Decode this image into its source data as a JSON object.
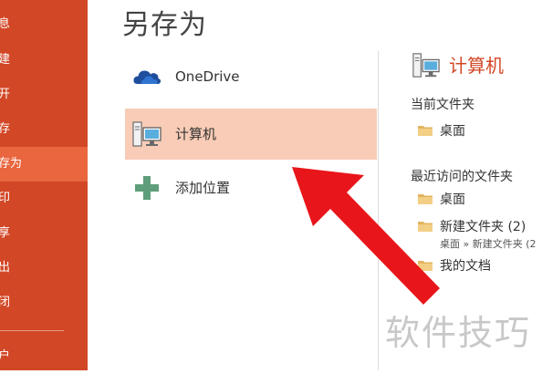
{
  "sidebar": {
    "items": [
      {
        "label": "息"
      },
      {
        "label": "建"
      },
      {
        "label": "开"
      },
      {
        "label": "存"
      },
      {
        "label": "存为"
      },
      {
        "label": "印"
      },
      {
        "label": "享"
      },
      {
        "label": "出"
      },
      {
        "label": "闭"
      },
      {
        "label": "户"
      }
    ],
    "active_index": 4
  },
  "page": {
    "title": "另存为"
  },
  "places": [
    {
      "label": "OneDrive",
      "icon": "cloud-icon"
    },
    {
      "label": "计算机",
      "icon": "computer-icon",
      "selected": true
    },
    {
      "label": "添加位置",
      "icon": "plus-icon"
    }
  ],
  "right_pane": {
    "title": "计算机",
    "current_folder_heading": "当前文件夹",
    "current_folders": [
      {
        "name": "桌面"
      }
    ],
    "recent_heading": "最近访问的文件夹",
    "recent_folders": [
      {
        "name": "桌面"
      },
      {
        "name": "新建文件夹 (2)",
        "path": "桌面 » 新建文件夹 (2"
      },
      {
        "name": "我的文档"
      }
    ]
  },
  "watermark": "软件技巧",
  "colors": {
    "sidebar": "#d24726",
    "sidebar_active": "#e9663f",
    "selection": "#f8ccb6",
    "accent": "#d24726",
    "arrow": "#e8161a"
  }
}
